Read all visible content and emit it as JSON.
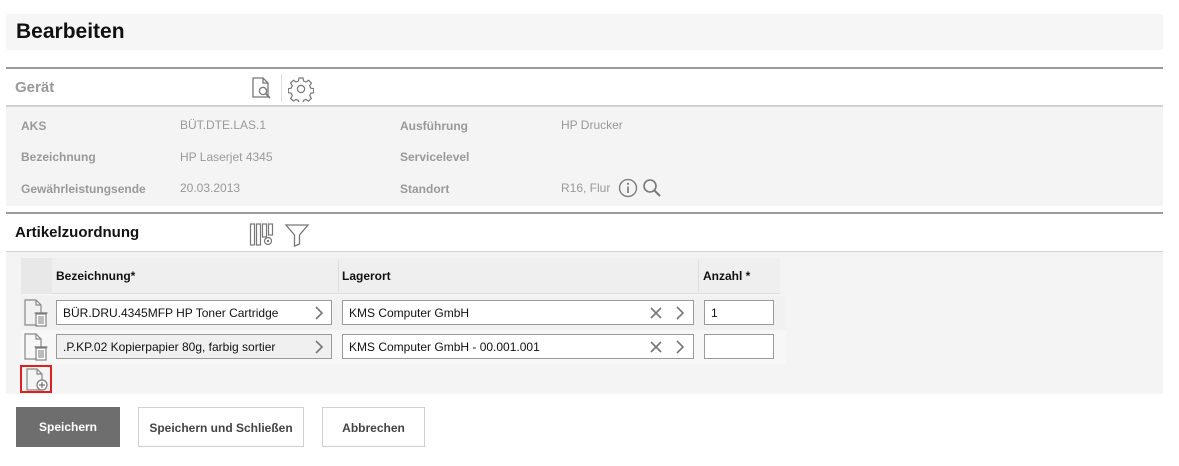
{
  "header": {
    "title": "Bearbeiten"
  },
  "geraet": {
    "title": "Gerät",
    "fields": [
      {
        "label": "AKS",
        "value": "BÜT.DTE.LAS.1"
      },
      {
        "label": "Bezeichnung",
        "value": "HP Laserjet 4345"
      },
      {
        "label": "Gewährleistungsende",
        "value": "20.03.2013"
      },
      {
        "label": "Ausführung",
        "value": "HP Drucker"
      },
      {
        "label": "Servicelevel",
        "value": ""
      },
      {
        "label": "Standort",
        "value": "R16, Flur"
      }
    ]
  },
  "artikel": {
    "title": "Artikelzuordnung",
    "columns": {
      "bezeichnung": "Bezeichnung*",
      "lagerort": "Lagerort",
      "anzahl": "Anzahl *"
    },
    "rows": [
      {
        "bezeichnung": "BÜR.DRU.4345MFP HP Toner Cartridge",
        "lagerort": "KMS Computer GmbH",
        "anzahl": "1"
      },
      {
        "bezeichnung": ".P.KP.02 Kopierpapier 80g, farbig sortier",
        "lagerort": "KMS Computer GmbH - 00.001.001",
        "anzahl": ""
      }
    ]
  },
  "actions": {
    "save": "Speichern",
    "save_close": "Speichern und Schließen",
    "cancel": "Abbrechen"
  },
  "colors": {
    "primary_button": "#6e6e6e",
    "highlight": "#e02020",
    "section_bg": "#f4f4f4"
  }
}
